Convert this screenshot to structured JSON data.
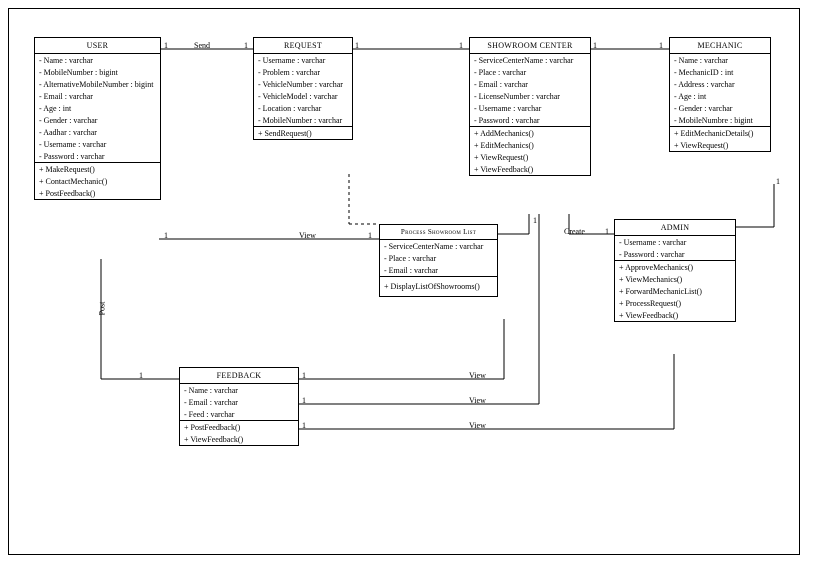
{
  "classes": {
    "user": {
      "title": "USER",
      "attrs": [
        "- Name : varchar",
        "- MobileNumber : bigint",
        "- AlternativeMobileNumber : bigint",
        "- Email : varchar",
        "- Age : int",
        "- Gender : varchar",
        "- Aadhar : varchar",
        "- Username : varchar",
        "- Password : varchar"
      ],
      "ops": [
        "+ MakeRequest()",
        "+ ContactMechanic()",
        "+ PostFeedback()"
      ]
    },
    "request": {
      "title": "REQUEST",
      "attrs": [
        "- Username : varchar",
        "- Problem : varchar",
        "- VehicleNumber : varchar",
        "- VehicleModel : varchar",
        "- Location : varchar",
        "- MobileNumber : varchar"
      ],
      "ops": [
        "+ SendRequest()"
      ]
    },
    "showroom": {
      "title": "SHOWROOM CENTER",
      "attrs": [
        "- ServiceCenterName : varchar",
        "- Place : varchar",
        "- Email : varchar",
        "- LicenseNumber : varchar",
        "- Username : varchar",
        "- Password : varchar"
      ],
      "ops": [
        "+ AddMechanics()",
        "+ EditMechanics()",
        "+ ViewRequest()",
        "+ ViewFeedback()"
      ]
    },
    "mechanic": {
      "title": "MECHANIC",
      "attrs": [
        "- Name : varchar",
        "- MechanicID : int",
        "- Address : varchar",
        "- Age : int",
        "- Gender : varchar",
        "- MobileNumbre : bigint"
      ],
      "ops": [
        "+ EditMechanicDetails()",
        "+ ViewRequest()"
      ]
    },
    "processList": {
      "title": "Process Showroom List",
      "attrs": [
        "- ServiceCenterName : varchar",
        "- Place : varchar",
        "- Email : varchar"
      ],
      "ops": [
        "+ DisplayListOfShowrooms()"
      ]
    },
    "admin": {
      "title": "ADMIN",
      "attrs": [
        "- Username : varchar",
        "- Password : varchar"
      ],
      "ops": [
        "+ ApproveMechanics()",
        "+ ViewMechanics()",
        "+ ForwardMechanicList()",
        "+ ProcessRequest()",
        "+ ViewFeedback()"
      ]
    },
    "feedback": {
      "title": "FEEDBACK",
      "attrs": [
        "- Name : varchar",
        "- Email : varchar",
        "- Feed : varchar"
      ],
      "ops": [
        "+ PostFeedback()",
        "+ ViewFeedback()"
      ]
    }
  },
  "labels": {
    "send": "Send",
    "view": "View",
    "post": "Post",
    "create": "Create",
    "one": "1"
  }
}
